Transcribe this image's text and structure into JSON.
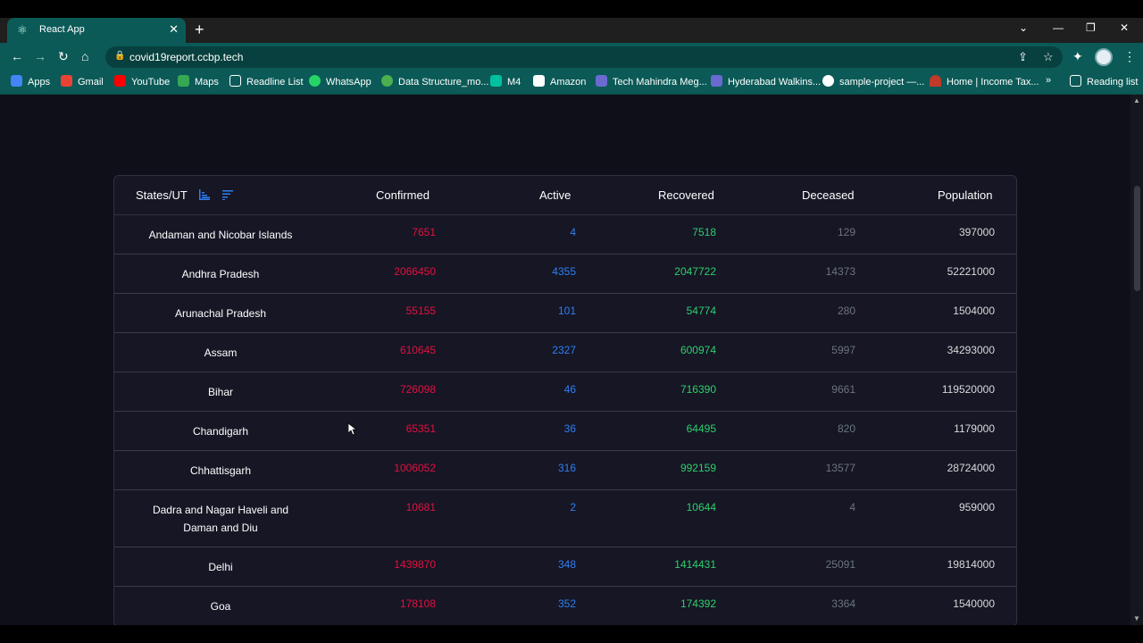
{
  "browser": {
    "tab_title": "React App",
    "url": "covid19report.ccbp.tech",
    "bookmarks": [
      {
        "label": "Apps",
        "color": "#4285f4"
      },
      {
        "label": "Gmail",
        "color": "#ea4335"
      },
      {
        "label": "YouTube",
        "color": "#ff0000"
      },
      {
        "label": "Maps",
        "color": "#34a853"
      },
      {
        "label": "Readline List",
        "color": "#ffffff"
      },
      {
        "label": "WhatsApp",
        "color": "#25d366"
      },
      {
        "label": "Data Structure_mo...",
        "color": "#4caf50"
      },
      {
        "label": "M4",
        "color": "#00c0a0"
      },
      {
        "label": "Amazon",
        "color": "#ffffff"
      },
      {
        "label": "Tech Mahindra Meg...",
        "color": "#6a6ad0"
      },
      {
        "label": "Hyderabad Walkins...",
        "color": "#6a6ad0"
      },
      {
        "label": "sample-project —...",
        "color": "#ffffff"
      },
      {
        "label": "Home | Income Tax...",
        "color": "#c0392b"
      },
      {
        "label": "Reading list",
        "color": "#ffffff"
      }
    ]
  },
  "table": {
    "headers": {
      "state": "States/UT",
      "confirmed": "Confirmed",
      "active": "Active",
      "recovered": "Recovered",
      "deceased": "Deceased",
      "population": "Population"
    },
    "rows": [
      {
        "state": "Andaman and Nicobar Islands",
        "confirmed": "7651",
        "active": "4",
        "recovered": "7518",
        "deceased": "129",
        "population": "397000"
      },
      {
        "state": "Andhra Pradesh",
        "confirmed": "2066450",
        "active": "4355",
        "recovered": "2047722",
        "deceased": "14373",
        "population": "52221000"
      },
      {
        "state": "Arunachal Pradesh",
        "confirmed": "55155",
        "active": "101",
        "recovered": "54774",
        "deceased": "280",
        "population": "1504000"
      },
      {
        "state": "Assam",
        "confirmed": "610645",
        "active": "2327",
        "recovered": "600974",
        "deceased": "5997",
        "population": "34293000"
      },
      {
        "state": "Bihar",
        "confirmed": "726098",
        "active": "46",
        "recovered": "716390",
        "deceased": "9661",
        "population": "119520000"
      },
      {
        "state": "Chandigarh",
        "confirmed": "65351",
        "active": "36",
        "recovered": "64495",
        "deceased": "820",
        "population": "1179000"
      },
      {
        "state": "Chhattisgarh",
        "confirmed": "1006052",
        "active": "316",
        "recovered": "992159",
        "deceased": "13577",
        "population": "28724000"
      },
      {
        "state": "Dadra and Nagar Haveli and Daman and Diu",
        "confirmed": "10681",
        "active": "2",
        "recovered": "10644",
        "deceased": "4",
        "population": "959000"
      },
      {
        "state": "Delhi",
        "confirmed": "1439870",
        "active": "348",
        "recovered": "1414431",
        "deceased": "25091",
        "population": "19814000"
      },
      {
        "state": "Goa",
        "confirmed": "178108",
        "active": "352",
        "recovered": "174392",
        "deceased": "3364",
        "population": "1540000"
      }
    ]
  }
}
